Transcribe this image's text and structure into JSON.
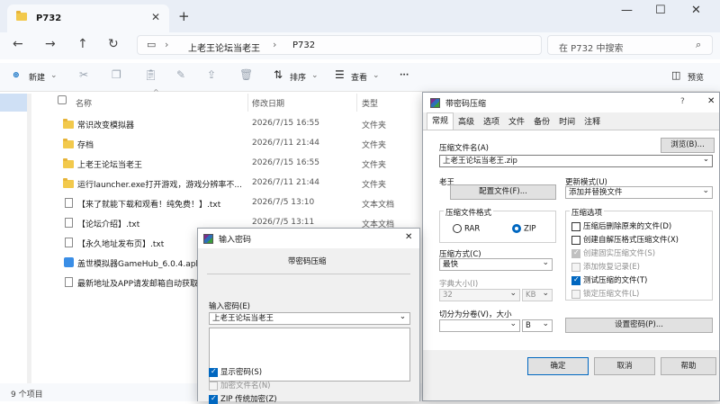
{
  "explorer": {
    "tab_title": "P732",
    "breadcrumb": [
      "上老王论坛当老王",
      "P732"
    ],
    "search_placeholder": "在 P732 中搜索",
    "toolbar": {
      "new": "新建",
      "sort": "排序",
      "view": "查看",
      "more": "···",
      "preview": "预览"
    },
    "columns": {
      "name": "名称",
      "date": "修改日期",
      "type": "类型"
    },
    "files": [
      {
        "name": "常识改变模拟器",
        "date": "2026/7/15 16:55",
        "type": "文件夹",
        "icon": "folder"
      },
      {
        "name": "存档",
        "date": "2026/7/11 21:44",
        "type": "文件夹",
        "icon": "folder"
      },
      {
        "name": "上老王论坛当老王",
        "date": "2026/7/15 16:55",
        "type": "文件夹",
        "icon": "folder"
      },
      {
        "name": "运行launcher.exe打开游戏，游戏分辨率不...",
        "date": "2026/7/11 21:44",
        "type": "文件夹",
        "icon": "folder"
      },
      {
        "name": "【来了就能下载和观看！纯免费！】.txt",
        "date": "2026/7/5 13:10",
        "type": "文本文档",
        "icon": "doc"
      },
      {
        "name": "【论坛介绍】.txt",
        "date": "2026/7/5 13:11",
        "type": "文本文档",
        "icon": "doc"
      },
      {
        "name": "【永久地址发布页】.txt",
        "date": "",
        "type": "",
        "icon": "doc"
      },
      {
        "name": "盖世模拟器GameHub_6.0.4.apk",
        "date": "",
        "type": "",
        "icon": "apk"
      },
      {
        "name": "最新地址及APP请发邮箱自动获取",
        "date": "",
        "type": "",
        "icon": "doc"
      }
    ],
    "status": "9 个项目"
  },
  "rar": {
    "title": "带密码压缩",
    "help_glyph": "?",
    "tabs": [
      "常规",
      "高级",
      "选项",
      "文件",
      "备份",
      "时间",
      "注释"
    ],
    "archive_name_label": "压缩文件名(A)",
    "archive_name": "上老王论坛当老王.zip",
    "browse": "浏览(B)...",
    "profile_label": "老王",
    "profile_button": "配置文件(F)...",
    "update_mode_label": "更新模式(U)",
    "update_mode": "添加并替换文件",
    "format_label": "压缩文件格式",
    "format_rar": "RAR",
    "format_zip": "ZIP",
    "options_label": "压缩选项",
    "options": [
      {
        "label": "压缩后删除原来的文件(D)",
        "state": "off"
      },
      {
        "label": "创建自解压格式压缩文件(X)",
        "state": "off"
      },
      {
        "label": "创建固实压缩文件(S)",
        "state": "dis"
      },
      {
        "label": "添加恢复记录(E)",
        "state": "dis"
      },
      {
        "label": "测试压缩的文件(T)",
        "state": "on"
      },
      {
        "label": "锁定压缩文件(L)",
        "state": "dis"
      }
    ],
    "method_label": "压缩方式(C)",
    "method": "最快",
    "dict_label": "字典大小(I)",
    "dict": "32",
    "dict_unit": "KB",
    "split_label": "切分为分卷(V)，大小",
    "split_unit": "B",
    "set_password": "设置密码(P)...",
    "ok": "确定",
    "cancel": "取消",
    "help": "帮助"
  },
  "pwd": {
    "title": "输入密码",
    "heading": "带密码压缩",
    "label": "输入密码(E)",
    "value": "上老王论坛当老王",
    "show_password": "显示密码(S)",
    "encrypt_names": "加密文件名(N)",
    "zip_legacy": "ZIP 传统加密(Z)"
  }
}
